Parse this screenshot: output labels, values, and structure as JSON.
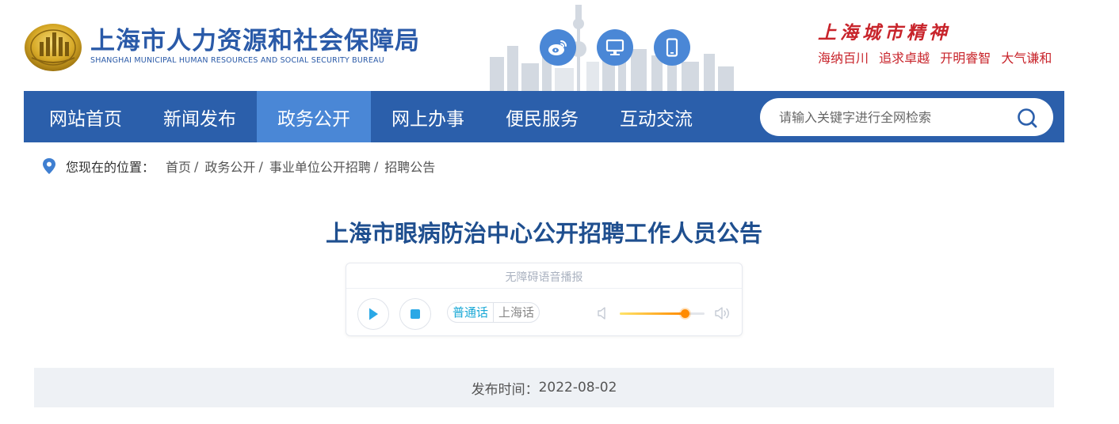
{
  "header": {
    "title": "上海市人力资源和社会保障局",
    "subtitle": "SHANGHAI MUNICIPAL HUMAN RESOURCES AND SOCIAL SECURITY BUREAU",
    "social_buttons": [
      {
        "icon": "weibo-icon"
      },
      {
        "icon": "monitor-icon"
      },
      {
        "icon": "mobile-icon"
      }
    ],
    "city_spirit": {
      "title": "上海城市精神",
      "slogans": [
        "海纳百川",
        "追求卓越",
        "开明睿智",
        "大气谦和"
      ]
    }
  },
  "nav": {
    "items": [
      {
        "label": "网站首页",
        "active": false
      },
      {
        "label": "新闻发布",
        "active": false
      },
      {
        "label": "政务公开",
        "active": true
      },
      {
        "label": "网上办事",
        "active": false
      },
      {
        "label": "便民服务",
        "active": false
      },
      {
        "label": "互动交流",
        "active": false
      }
    ],
    "search_placeholder": "请输入关键字进行全网检索"
  },
  "breadcrumb": {
    "label": "您现在的位置：",
    "items": [
      "首页",
      "政务公开",
      "事业单位公开招聘",
      "招聘公告"
    ],
    "separator": "/"
  },
  "article": {
    "title": "上海市眼病防治中心公开招聘工作人员公告"
  },
  "audio": {
    "label": "无障碍语音播报",
    "languages": [
      {
        "label": "普通话",
        "active": true
      },
      {
        "label": "上海话",
        "active": false
      }
    ],
    "volume_fraction": 0.77
  },
  "publish": {
    "label": "发布时间：",
    "date": "2022-08-02"
  },
  "colors": {
    "nav_bg": "#2b5fab",
    "nav_active": "#4a87d6",
    "brand_blue": "#2a5aa8",
    "title_blue": "#1f4f8f",
    "spirit_red": "#c8242b",
    "accent_cyan": "#19a8d6",
    "volume_orange": "#ff8a00"
  }
}
